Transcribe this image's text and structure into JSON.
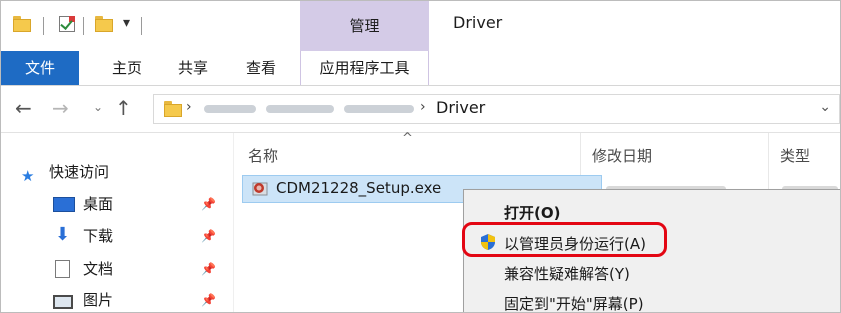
{
  "window": {
    "title": "Driver",
    "contextual_group": "管理"
  },
  "ribbon": {
    "tabs": {
      "file": "文件",
      "home": "主页",
      "share": "共享",
      "view": "查看",
      "app_tools": "应用程序工具"
    }
  },
  "address": {
    "current": "Driver"
  },
  "nav_pane": {
    "quick_access": "快速访问",
    "items": [
      {
        "label": "桌面",
        "icon": "desktop-icon"
      },
      {
        "label": "下载",
        "icon": "download-arrow-icon"
      },
      {
        "label": "文档",
        "icon": "document-icon"
      },
      {
        "label": "图片",
        "icon": "pictures-icon"
      }
    ]
  },
  "columns": {
    "name": "名称",
    "modified": "修改日期",
    "type": "类型"
  },
  "files": [
    {
      "name": "CDM21228_Setup.exe",
      "icon": "installer-exe-icon",
      "selected": true
    }
  ],
  "context_menu": {
    "open": "打开(O)",
    "run_as_admin": "以管理员身份运行(A)",
    "compat": "兼容性疑难解答(Y)",
    "pin_start": "固定到\"开始\"屏幕(P)"
  },
  "colors": {
    "file_tab": "#1e6bc4",
    "contextual_tab": "#d4cbe7",
    "selection": "#cce4f8",
    "highlight_border": "#e30613",
    "shield_blue": "#2a6fd6",
    "shield_yellow": "#f2c20f"
  }
}
